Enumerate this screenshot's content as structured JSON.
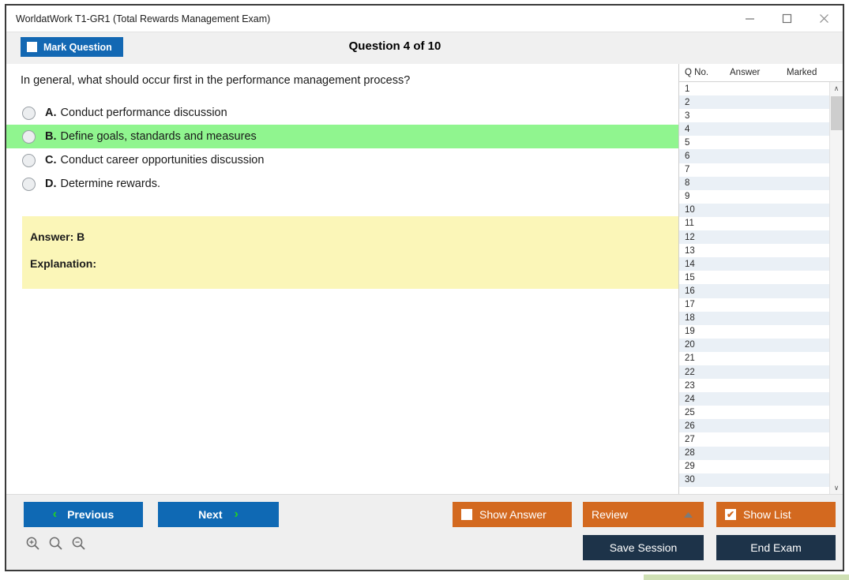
{
  "window": {
    "title": "WorldatWork T1-GR1 (Total Rewards Management Exam)",
    "controls": {
      "minimize": "minimize-icon",
      "maximize": "maximize-icon",
      "close": "close-icon"
    }
  },
  "toolbar": {
    "mark_question_label": "Mark Question",
    "mark_question_checked": false,
    "question_heading": "Question 4 of 10"
  },
  "question": {
    "stem": "In general, what should occur first in the performance management process?",
    "options": [
      {
        "letter": "A.",
        "text": "Conduct performance discussion",
        "selected": false,
        "highlighted": false
      },
      {
        "letter": "B.",
        "text": "Define goals, standards and measures",
        "selected": false,
        "highlighted": true
      },
      {
        "letter": "C.",
        "text": "Conduct career opportunities discussion",
        "selected": false,
        "highlighted": false
      },
      {
        "letter": "D.",
        "text": "Determine rewards.",
        "selected": false,
        "highlighted": false
      }
    ],
    "answer_label": "Answer: B",
    "explanation_label": "Explanation:"
  },
  "question_list": {
    "columns": [
      "Q No.",
      "Answer",
      "Marked"
    ],
    "rows": [
      {
        "no": "1",
        "answer": "",
        "marked": ""
      },
      {
        "no": "2",
        "answer": "",
        "marked": ""
      },
      {
        "no": "3",
        "answer": "",
        "marked": ""
      },
      {
        "no": "4",
        "answer": "",
        "marked": ""
      },
      {
        "no": "5",
        "answer": "",
        "marked": ""
      },
      {
        "no": "6",
        "answer": "",
        "marked": ""
      },
      {
        "no": "7",
        "answer": "",
        "marked": ""
      },
      {
        "no": "8",
        "answer": "",
        "marked": ""
      },
      {
        "no": "9",
        "answer": "",
        "marked": ""
      },
      {
        "no": "10",
        "answer": "",
        "marked": ""
      },
      {
        "no": "11",
        "answer": "",
        "marked": ""
      },
      {
        "no": "12",
        "answer": "",
        "marked": ""
      },
      {
        "no": "13",
        "answer": "",
        "marked": ""
      },
      {
        "no": "14",
        "answer": "",
        "marked": ""
      },
      {
        "no": "15",
        "answer": "",
        "marked": ""
      },
      {
        "no": "16",
        "answer": "",
        "marked": ""
      },
      {
        "no": "17",
        "answer": "",
        "marked": ""
      },
      {
        "no": "18",
        "answer": "",
        "marked": ""
      },
      {
        "no": "19",
        "answer": "",
        "marked": ""
      },
      {
        "no": "20",
        "answer": "",
        "marked": ""
      },
      {
        "no": "21",
        "answer": "",
        "marked": ""
      },
      {
        "no": "22",
        "answer": "",
        "marked": ""
      },
      {
        "no": "23",
        "answer": "",
        "marked": ""
      },
      {
        "no": "24",
        "answer": "",
        "marked": ""
      },
      {
        "no": "25",
        "answer": "",
        "marked": ""
      },
      {
        "no": "26",
        "answer": "",
        "marked": ""
      },
      {
        "no": "27",
        "answer": "",
        "marked": ""
      },
      {
        "no": "28",
        "answer": "",
        "marked": ""
      },
      {
        "no": "29",
        "answer": "",
        "marked": ""
      },
      {
        "no": "30",
        "answer": "",
        "marked": ""
      }
    ],
    "scroll_up_glyph": "∧",
    "scroll_down_glyph": "∨"
  },
  "bottom": {
    "previous_label": "Previous",
    "next_label": "Next",
    "previous_chevron": "‹",
    "next_chevron": "›",
    "zoom_icons": [
      "zoom-in-icon",
      "zoom-reset-icon",
      "zoom-out-icon"
    ],
    "show_answer_label": "Show Answer",
    "show_answer_checked": false,
    "review_label": "Review",
    "review_caret": "▲",
    "show_list_label": "Show List",
    "show_list_checked": true,
    "show_list_check_glyph": "✔",
    "save_session_label": "Save Session",
    "end_exam_label": "End Exam"
  },
  "colors": {
    "primary_blue": "#0f69b4",
    "orange": "#d3691f",
    "dark_navy": "#1d3349",
    "highlight_green": "#90f58f",
    "answer_yellow": "#fbf6b8",
    "chevron_green": "#23d321"
  }
}
